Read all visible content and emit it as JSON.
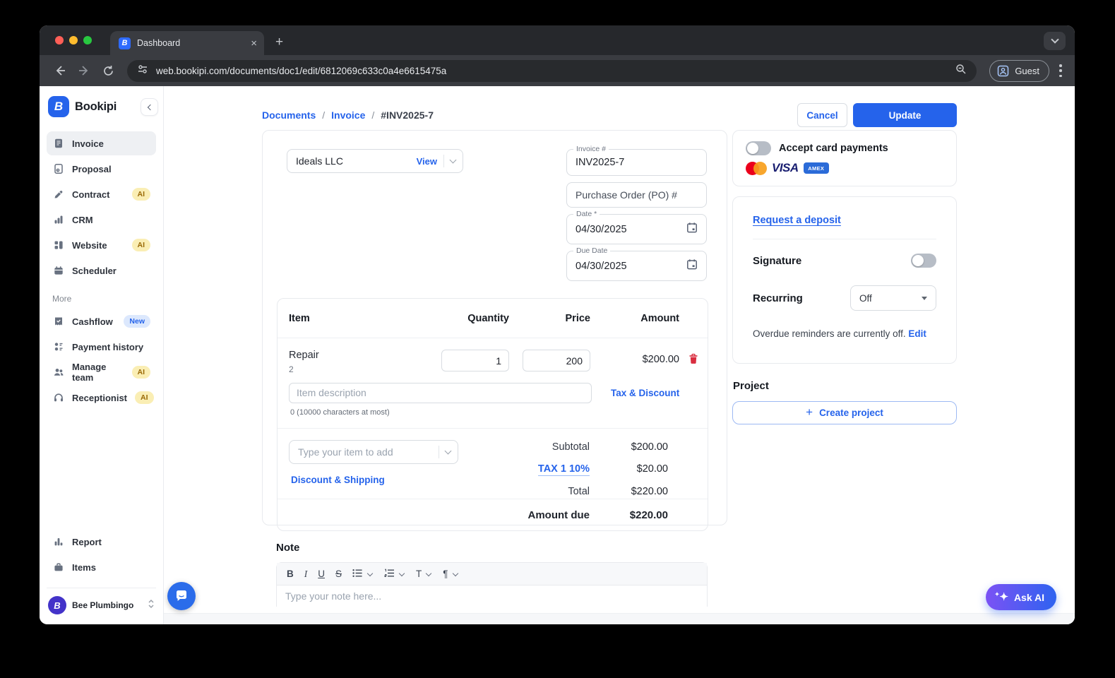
{
  "browser": {
    "tab_title": "Dashboard",
    "url": "web.bookipi.com/documents/doc1/edit/6812069c633c0a4e6615475a",
    "guest_label": "Guest"
  },
  "sidebar": {
    "brand": "Bookipi",
    "items": [
      {
        "label": "Invoice",
        "badge": ""
      },
      {
        "label": "Proposal",
        "badge": ""
      },
      {
        "label": "Contract",
        "badge": "AI"
      },
      {
        "label": "CRM",
        "badge": ""
      },
      {
        "label": "Website",
        "badge": "AI"
      },
      {
        "label": "Scheduler",
        "badge": ""
      }
    ],
    "more_label": "More",
    "more_items": [
      {
        "label": "Cashflow",
        "badge": "New"
      },
      {
        "label": "Payment history",
        "badge": ""
      },
      {
        "label": "Manage team",
        "badge": "AI"
      },
      {
        "label": "Receptionist",
        "badge": "AI"
      }
    ],
    "bottom_items": [
      {
        "label": "Report"
      },
      {
        "label": "Items"
      }
    ],
    "workspace": "Bee Plumbingo"
  },
  "header": {
    "breadcrumb": [
      "Documents",
      "Invoice",
      "#INV2025-7"
    ],
    "cancel_label": "Cancel",
    "update_label": "Update"
  },
  "invoice": {
    "customer_name": "Ideals LLC",
    "view_label": "View",
    "invoice_number_label": "Invoice #",
    "invoice_number": "INV2025-7",
    "po_placeholder": "Purchase Order (PO) #",
    "date_label": "Date *",
    "date_value": "04/30/2025",
    "due_date_label": "Due Date",
    "due_date_value": "04/30/2025",
    "table_headers": [
      "Item",
      "Quantity",
      "Price",
      "Amount"
    ],
    "items": [
      {
        "name": "Repair",
        "subtext": "2",
        "quantity": "1",
        "price": "200",
        "amount": "$200.00"
      }
    ],
    "description_placeholder": "Item description",
    "char_counter": "0 (10000 characters at most)",
    "tax_discount_label": "Tax & Discount",
    "add_item_placeholder": "Type your item to add",
    "discount_shipping_label": "Discount & Shipping",
    "totals": {
      "subtotal_label": "Subtotal",
      "subtotal": "$200.00",
      "tax_label": "TAX 1 10%",
      "tax": "$20.00",
      "total_label": "Total",
      "total": "$220.00",
      "amount_due_label": "Amount due",
      "amount_due": "$220.00"
    },
    "note_label": "Note",
    "note_placeholder": "Type your note here...",
    "note_toolbar": {
      "bold": "B",
      "italic": "I",
      "underline": "U",
      "strike": "S",
      "text_size": "T",
      "paragraph": "¶"
    }
  },
  "panel": {
    "card_payments_label": "Accept card payments",
    "visa_text": "VISA",
    "amex_text": "AMEX",
    "deposit_link": "Request a deposit",
    "signature_label": "Signature",
    "recurring_label": "Recurring",
    "recurring_value": "Off",
    "overdue_text": "Overdue reminders are currently off.",
    "edit_link": "Edit",
    "project_label": "Project",
    "create_project_label": "Create project"
  },
  "ask_ai_label": "Ask AI",
  "colors": {
    "accent": "#2563eb",
    "ai_badge_bg": "#faeeb4",
    "ai_badge_text": "#9a6a07",
    "new_badge_bg": "#dce8fd",
    "mastercard_red": "#eb001b",
    "mastercard_orange": "#f79e1b",
    "visa_blue": "#1a1f71",
    "amex_blue": "#2b6bd8",
    "danger_red": "#d92d3f",
    "askai_gradient_start": "#7b52f4",
    "askai_gradient_end": "#2e63f0"
  }
}
